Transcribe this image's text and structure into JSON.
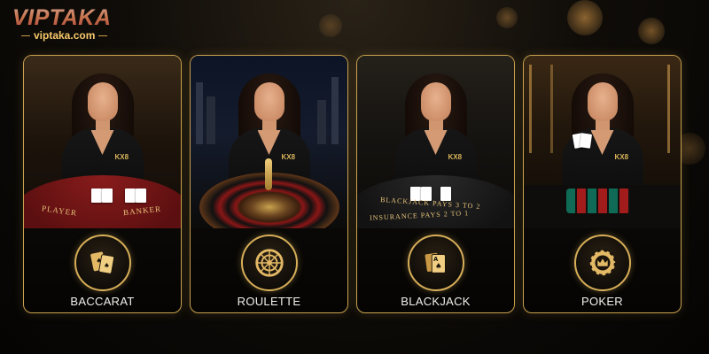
{
  "brand": {
    "name": "VIPTAKA",
    "domain": "viptaka.com"
  },
  "theme": {
    "accent": "#c9a24e",
    "background": "#0b0907"
  },
  "games": [
    {
      "label": "BACCARAT",
      "icon": "cards-icon",
      "table_text_1": "PLAYER",
      "table_text_2": "BANKER",
      "badge": "KX8"
    },
    {
      "label": "ROULETTE",
      "icon": "roulette-wheel-icon",
      "badge": "KX8"
    },
    {
      "label": "BLACKJACK",
      "icon": "ace-cards-icon",
      "table_text_1": "BLACKJACK PAYS 3 TO 2",
      "table_text_2": "INSURANCE PAYS 2 TO 1",
      "badge": "KX8"
    },
    {
      "label": "POKER",
      "icon": "crown-chip-icon",
      "badge": "KX8"
    }
  ]
}
